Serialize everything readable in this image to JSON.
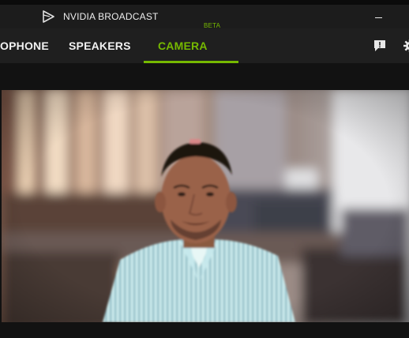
{
  "app": {
    "title": "NVIDIA BROADCAST",
    "accent_color": "#76b900"
  },
  "titlebar": {
    "logo_icon": "nvidia-broadcast-logo-icon",
    "minimize_icon": "minimize-icon"
  },
  "tabs": [
    {
      "label": "OPHONE",
      "active": false
    },
    {
      "label": "SPEAKERS",
      "active": false
    },
    {
      "label": "CAMERA",
      "badge": "BETA",
      "active": true
    }
  ],
  "toolbar": {
    "feedback_icon": "feedback-icon",
    "settings_icon": "settings-icon"
  },
  "preview": {
    "content": "live-camera-feed"
  }
}
